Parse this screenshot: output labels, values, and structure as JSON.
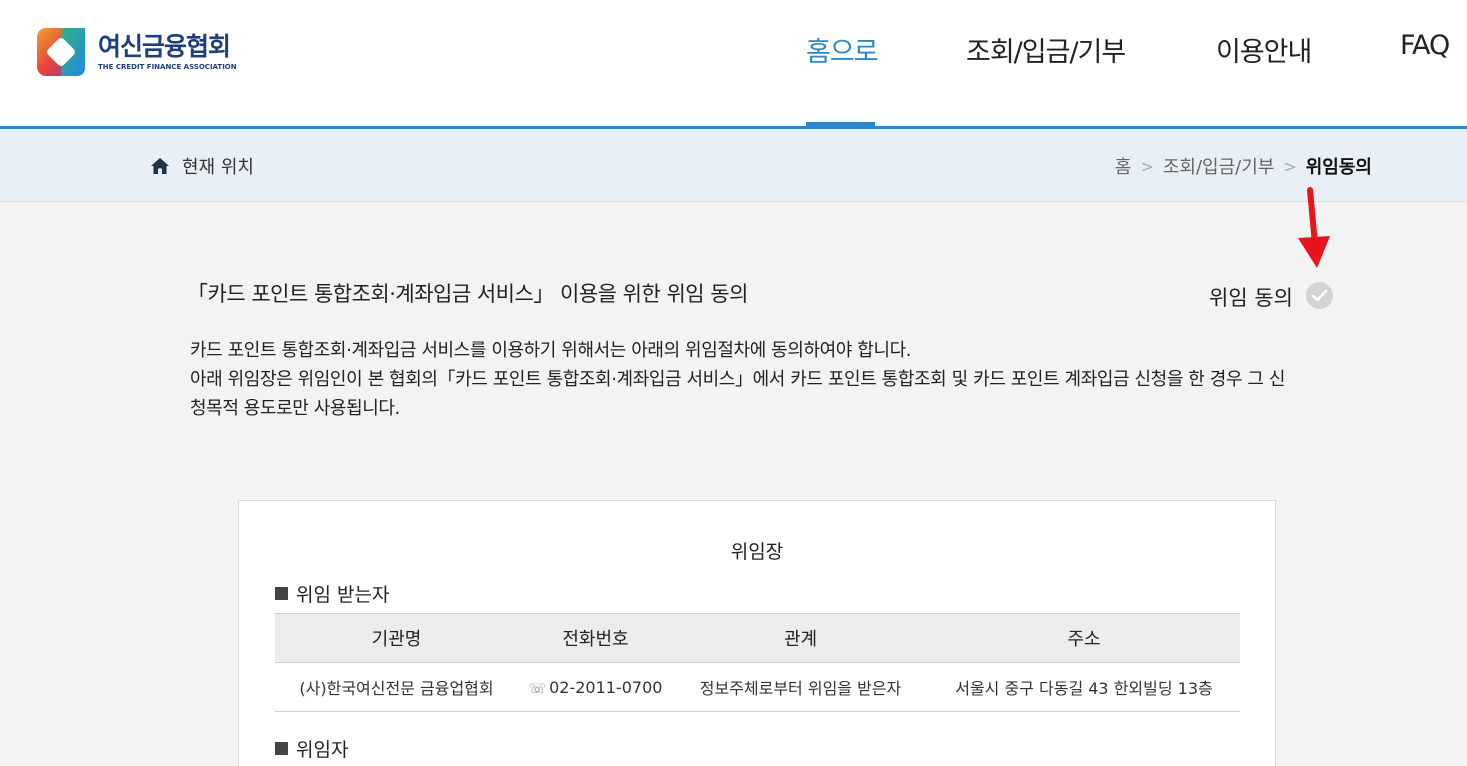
{
  "header": {
    "logo_ko": "여신금융협회",
    "logo_en": "THE CREDIT FINANCE ASSOCIATION",
    "nav": [
      {
        "label": "홈으로",
        "active": true
      },
      {
        "label": "조회/입금/기부",
        "active": false
      },
      {
        "label": "이용안내",
        "active": false
      },
      {
        "label": "FAQ",
        "active": false
      }
    ]
  },
  "breadcrumb": {
    "label": "현재 위치",
    "items": [
      "홈",
      "조회/입금/기부",
      "위임동의"
    ],
    "separator": ">"
  },
  "content": {
    "title": "「카드 포인트 통합조회·계좌입금 서비스」 이용을 위한 위임 동의",
    "consent_label": "위임 동의",
    "description_lines": [
      "카드 포인트 통합조회·계좌입금 서비스를 이용하기 위해서는 아래의 위임절차에 동의하여야 합니다.",
      "아래 위임장은 위임인이 본 협회의「카드 포인트 통합조회·계좌입금 서비스」에서 카드 포인트 통합조회 및 카드 포인트 계좌입금 신청을 한 경우 그 신",
      "청목적 용도로만 사용됩니다."
    ]
  },
  "letter": {
    "title": "위임장",
    "section_receiver": "위임 받는자",
    "section_delegator": "위임자",
    "table": {
      "headers": [
        "기관명",
        "전화번호",
        "관계",
        "주소"
      ],
      "rows": [
        [
          "(사)한국여신전문 금융업협회",
          "02-2011-0700",
          "정보주체로부터 위임을 받은자",
          "서울시 중구 다동길 43 한외빌딩 13층"
        ]
      ]
    }
  },
  "colors": {
    "accent": "#2f86c8",
    "brand": "#1e3f7a",
    "arrow": "#e8141b",
    "breadcrumb_bg": "#e9eff6",
    "page_bg": "#f3f3f3"
  }
}
